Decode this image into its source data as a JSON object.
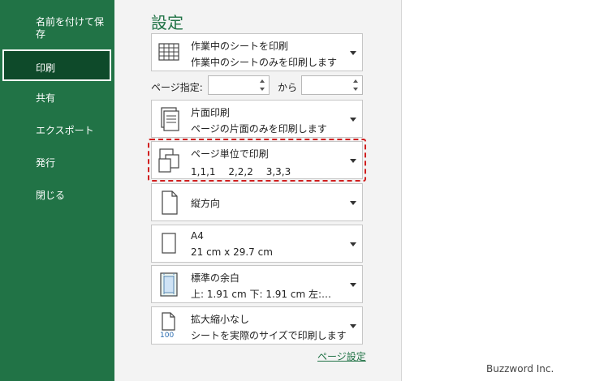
{
  "sidebar": {
    "items": [
      {
        "label": "名前を付けて保",
        "label2": "存"
      },
      {
        "label": "印刷"
      },
      {
        "label": "共有"
      },
      {
        "label": "エクスポート"
      },
      {
        "label": "発行"
      },
      {
        "label": "閉じる"
      }
    ]
  },
  "settings": {
    "title": "設定",
    "print_what": {
      "line1": "作業中のシートを印刷",
      "line2": "作業中のシートのみを印刷します",
      "icon": "sheet-grid-icon"
    },
    "pages": {
      "label": "ページ指定:",
      "from_value": "",
      "to_label": "から",
      "to_value": ""
    },
    "sides": {
      "line1": "片面印刷",
      "line2": "ページの片面のみを印刷します",
      "icon": "single-sided-icon"
    },
    "collate": {
      "line1": "ページ単位で印刷",
      "line2": "1,1,1　 2,2,2　 3,3,3",
      "icon": "collate-icon"
    },
    "orientation": {
      "line1": "縦方向",
      "icon": "portrait-page-icon"
    },
    "paper": {
      "line1": "A4",
      "line2": "21 cm x 29.7 cm",
      "icon": "paper-size-icon"
    },
    "margins": {
      "line1": "標準の余白",
      "line2": "上: 1.91 cm 下: 1.91 cm 左:…",
      "icon": "margins-icon"
    },
    "scaling": {
      "line1": "拡大縮小なし",
      "line2": "シートを実際のサイズで印刷します",
      "icon_text": "100",
      "icon": "scaling-icon"
    },
    "page_setup_link": "ページ設定"
  },
  "colors": {
    "sidebar_bg": "#217346",
    "active_bg": "#0e4a2a",
    "highlight": "#d11f1f"
  },
  "watermark": "Buzzword Inc."
}
